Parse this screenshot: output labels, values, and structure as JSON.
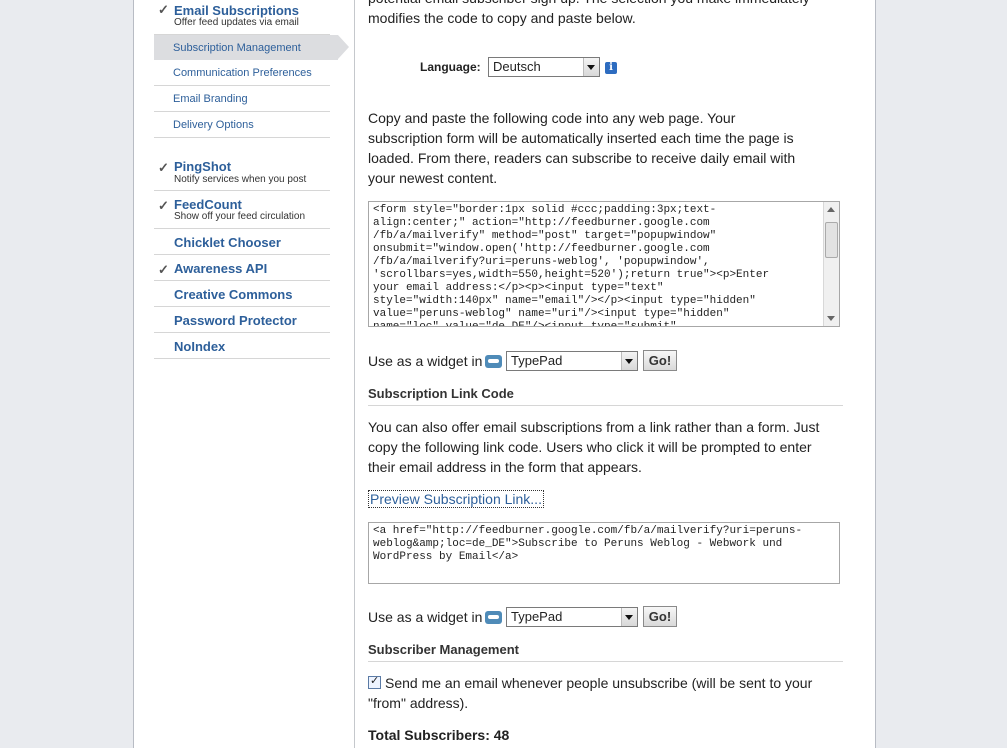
{
  "sidebar": {
    "email_subscriptions": {
      "title": "Email Subscriptions",
      "desc": "Offer feed updates via email",
      "check": "✓"
    },
    "sub_items": [
      {
        "label": "Subscription Management"
      },
      {
        "label": "Communication Preferences"
      },
      {
        "label": "Email Branding"
      },
      {
        "label": "Delivery Options"
      }
    ],
    "pingshot": {
      "title": "PingShot",
      "desc": "Notify services when you post",
      "check": "✓"
    },
    "feedcount": {
      "title": "FeedCount",
      "desc": "Show off your feed circulation",
      "check": "✓"
    },
    "chicklet": {
      "title": "Chicklet Chooser"
    },
    "awareness": {
      "title": "Awareness API",
      "check": "✓"
    },
    "creative": {
      "title": "Creative Commons"
    },
    "password": {
      "title": "Password Protector"
    },
    "noindex": {
      "title": "NoIndex"
    }
  },
  "main": {
    "intro_line1": "potential email subscriber sign up. The selection you make immediately",
    "intro_line2": "modifies the code to copy and paste below.",
    "language_label": "Language:",
    "language_value": "Deutsch",
    "info_glyph": "i",
    "copy_text": "Copy and paste the following code into any web page. Your subscription form will be automatically inserted each time the page is loaded. From there, readers can subscribe to receive daily email with your newest content.",
    "form_code": "<form style=\"border:1px solid #ccc;padding:3px;text-\nalign:center;\" action=\"http://feedburner.google.com\n/fb/a/mailverify\" method=\"post\" target=\"popupwindow\"\nonsubmit=\"window.open('http://feedburner.google.com\n/fb/a/mailverify?uri=peruns-weblog', 'popupwindow',\n'scrollbars=yes,width=550,height=520');return true\"><p>Enter\nyour email address:</p><p><input type=\"text\"\nstyle=\"width:140px\" name=\"email\"/></p><input type=\"hidden\"\nvalue=\"peruns-weblog\" name=\"uri\"/><input type=\"hidden\"\nname=\"loc\" value=\"de_DE\"/><input type=\"submit\"",
    "widget_label": "Use as a widget in",
    "widget_value": "TypePad",
    "go_label": "Go!",
    "link_section_title": "Subscription Link Code",
    "link_text": "You can also offer email subscriptions from a link rather than a form. Just copy the following link code. Users who click it will be prompted to enter their email address in the form that appears.",
    "preview_link": "Preview Subscription Link...",
    "link_code": "<a href=\"http://feedburner.google.com/fb/a/mailverify?uri=peruns-\nweblog&amp;loc=de_DE\">Subscribe to Peruns Weblog - Webwork und\nWordPress by Email</a>",
    "widget2_label": "Use as a widget in",
    "widget2_value": "TypePad",
    "go2_label": "Go!",
    "mgmt_title": "Subscriber Management",
    "notify_text": "Send me an email whenever people unsubscribe (will be sent to your \"from\" address).",
    "total_subscribers": "Total Subscribers: 48"
  }
}
